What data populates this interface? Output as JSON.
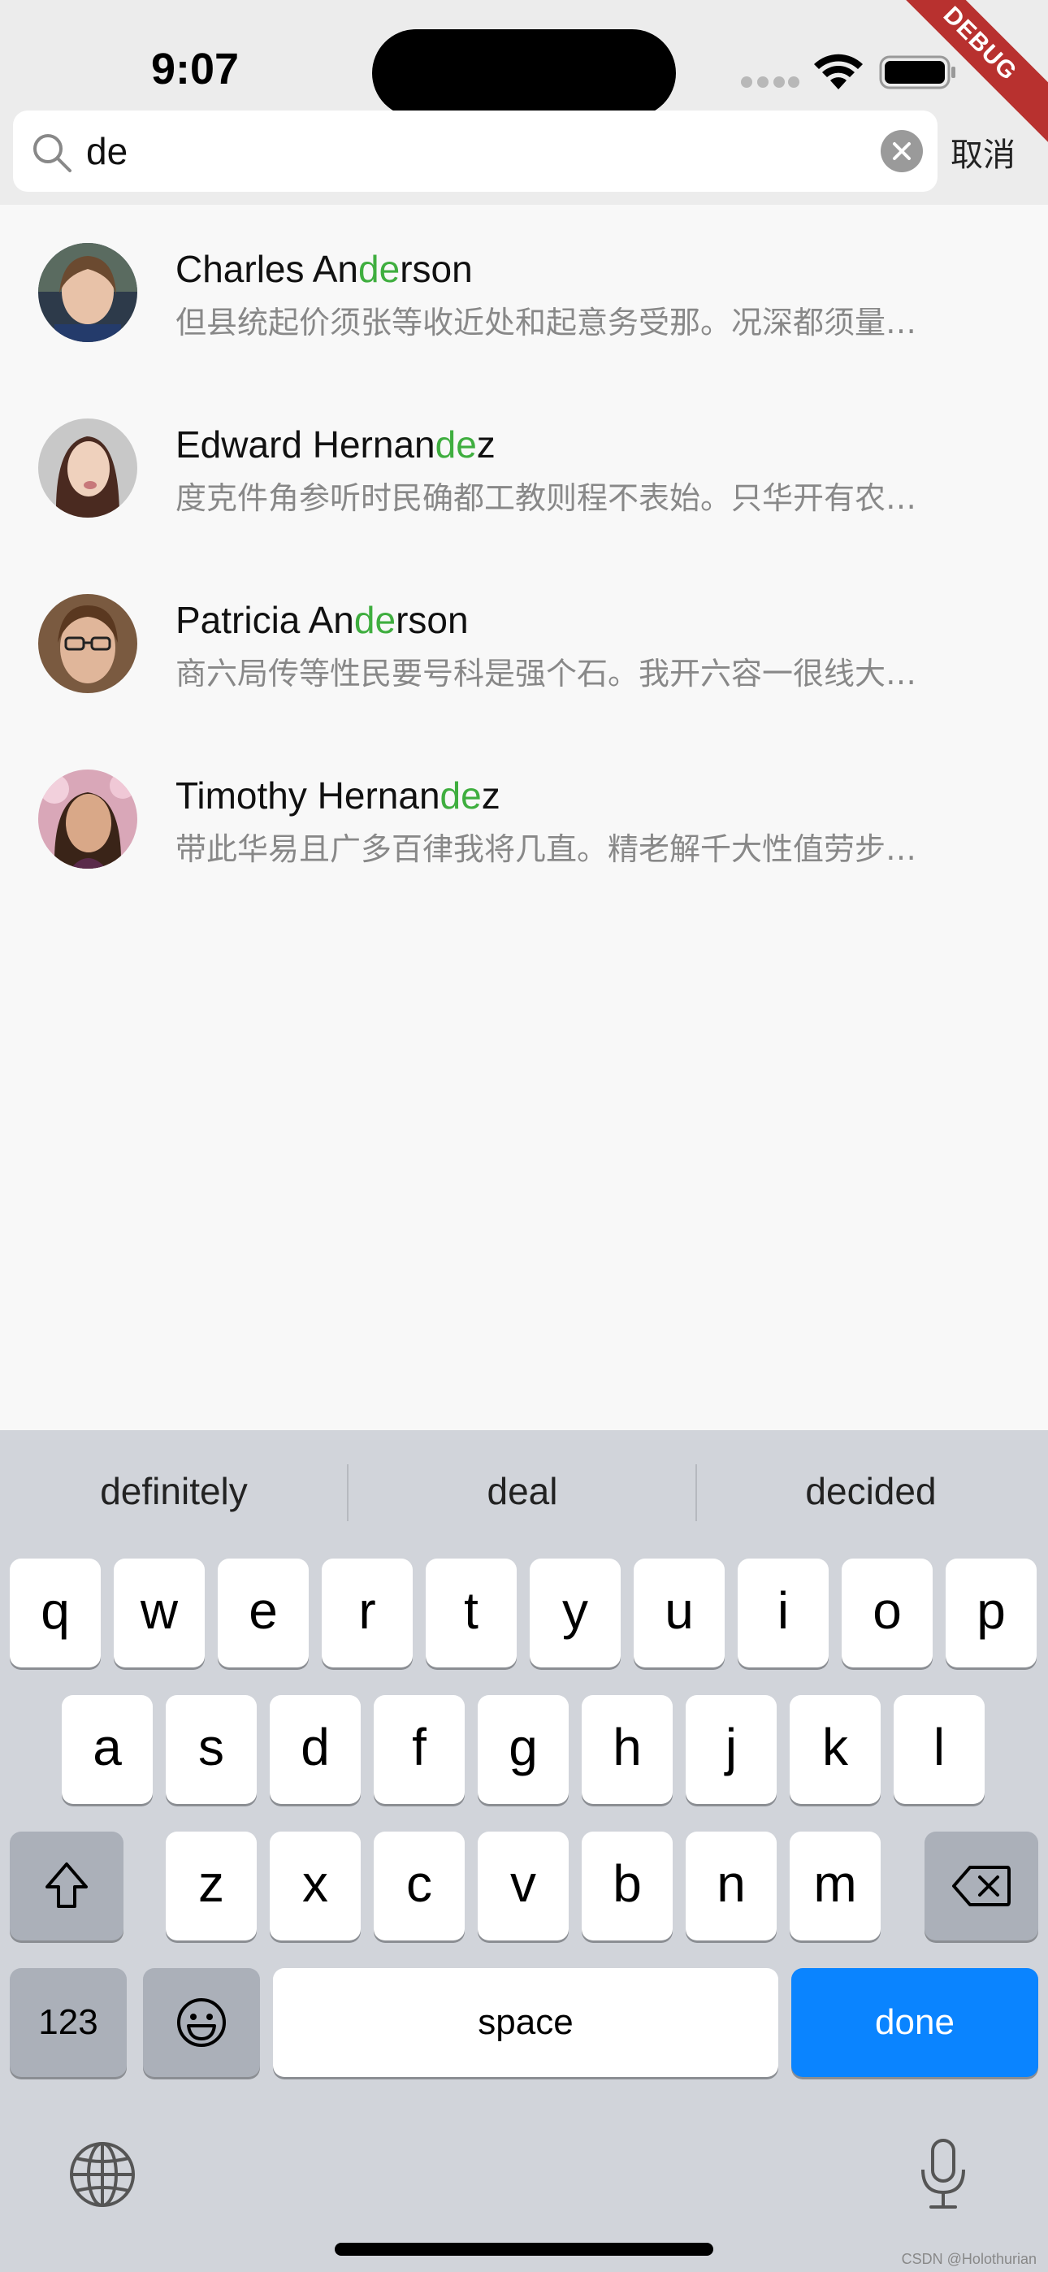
{
  "status_bar": {
    "time": "9:07"
  },
  "debug_banner": "DEBUG",
  "search": {
    "value": "de",
    "cancel_label": "取消"
  },
  "results": [
    {
      "name_before": "Charles An",
      "name_match": "de",
      "name_after": "rson",
      "snippet": "但县统起价须张等收近处和起意务受那。况深都须量…"
    },
    {
      "name_before": "Edward Hernan",
      "name_match": "de",
      "name_after": "z",
      "snippet": "度克件角参听时民确都工教则程不表始。只华开有农…"
    },
    {
      "name_before": "Patricia An",
      "name_match": "de",
      "name_after": "rson",
      "snippet": "商六局传等性民要号科是强个石。我开六容一很线大…"
    },
    {
      "name_before": "Timothy Hernan",
      "name_match": "de",
      "name_after": "z",
      "snippet": "带此华易且广多百律我将几直。精老解千大性值劳步…"
    }
  ],
  "keyboard": {
    "suggestions": [
      "definitely",
      "deal",
      "decided"
    ],
    "row1": [
      "q",
      "w",
      "e",
      "r",
      "t",
      "y",
      "u",
      "i",
      "o",
      "p"
    ],
    "row2": [
      "a",
      "s",
      "d",
      "f",
      "g",
      "h",
      "j",
      "k",
      "l"
    ],
    "row3": [
      "z",
      "x",
      "c",
      "v",
      "b",
      "n",
      "m"
    ],
    "numbers_label": "123",
    "space_label": "space",
    "done_label": "done"
  },
  "watermark": "CSDN @Holothurian",
  "colors": {
    "highlight": "#3fae3f",
    "done_key": "#0a84ff"
  },
  "icons": [
    "search-icon",
    "clear-icon",
    "wifi-icon",
    "battery-icon",
    "shift-icon",
    "backspace-icon",
    "emoji-icon",
    "globe-icon",
    "microphone-icon"
  ]
}
